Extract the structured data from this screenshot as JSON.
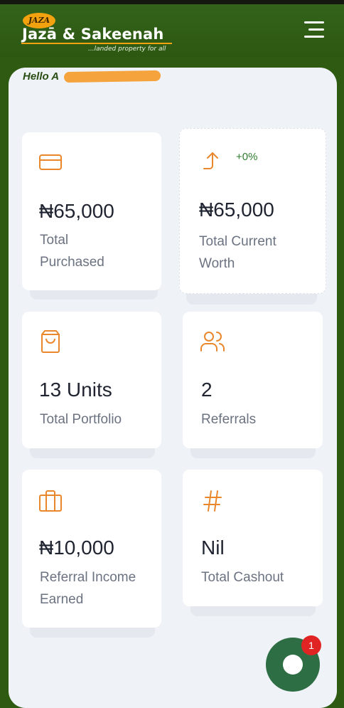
{
  "brand": {
    "badge": "JAZA",
    "name": "Jazā & Sakeenah",
    "tagline": "...landed property for all"
  },
  "greeting": "Hello A",
  "cards": {
    "purchased": {
      "value": "₦65,000",
      "label": "Total Purchased",
      "icon": "credit-card-icon"
    },
    "current_worth": {
      "value": "₦65,000",
      "label": "Total Current Worth",
      "change": "+0%",
      "icon": "arrow-up-right-icon"
    },
    "portfolio": {
      "value": "13 Units",
      "label": "Total Portfolio",
      "icon": "shopping-bag-icon"
    },
    "referrals": {
      "value": "2",
      "label": "Referrals",
      "icon": "users-icon"
    },
    "referral_income": {
      "value": "₦10,000",
      "label": "Referral Income Earned",
      "icon": "briefcase-icon"
    },
    "cashout": {
      "value": "Nil",
      "label": "Total Cashout",
      "icon": "hash-icon"
    }
  },
  "chat": {
    "notification_count": "1"
  },
  "colors": {
    "header_green": "#2e5a12",
    "accent_orange": "#e8872c",
    "panel_bg": "#eff2f7",
    "value_text": "#1f2430",
    "label_text": "#6b7280",
    "positive_green": "#2f7d2f",
    "badge_red": "#e02424"
  }
}
